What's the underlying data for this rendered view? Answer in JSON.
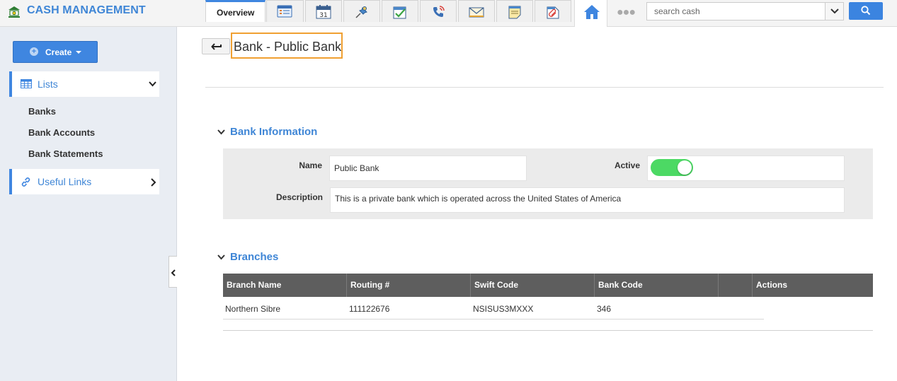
{
  "app": {
    "title": "CASH MANAGEMENT"
  },
  "search": {
    "placeholder": "search cash"
  },
  "sidebar": {
    "create_label": "Create",
    "groups": [
      {
        "label": "Lists",
        "icon": "table-icon",
        "expanded": true,
        "items": [
          "Banks",
          "Bank Accounts",
          "Bank Statements"
        ]
      },
      {
        "label": "Useful Links",
        "icon": "link-icon",
        "expanded": false
      }
    ]
  },
  "page": {
    "title": "Bank - Public Bank"
  },
  "tabs": [
    {
      "label": "Overview",
      "active": true
    },
    {
      "icon": "details-card-icon"
    },
    {
      "icon": "calendar-icon",
      "text": "31"
    },
    {
      "icon": "pin-icon"
    },
    {
      "icon": "task-check-icon"
    },
    {
      "icon": "phone-icon"
    },
    {
      "icon": "mail-icon"
    },
    {
      "icon": "note-icon"
    },
    {
      "icon": "attachment-icon"
    }
  ],
  "bank_info": {
    "title": "Bank Information",
    "name_label": "Name",
    "name_value": "Public Bank",
    "active_label": "Active",
    "active_value": true,
    "description_label": "Description",
    "description_value": "This is a private bank which is operated across the United States of America"
  },
  "branches": {
    "title": "Branches",
    "columns": [
      "Branch Name",
      "Routing #",
      "Swift Code",
      "Bank Code",
      "",
      "Actions"
    ],
    "rows": [
      {
        "branch_name": "Northern Sibre",
        "routing": "111122676",
        "swift": "NSISUS3MXXX",
        "bank_code": "346"
      }
    ]
  },
  "colors": {
    "accent": "#3f86d6",
    "button": "#3f86e0",
    "toggle_on": "#4cd964",
    "highlight": "#f0a032"
  }
}
